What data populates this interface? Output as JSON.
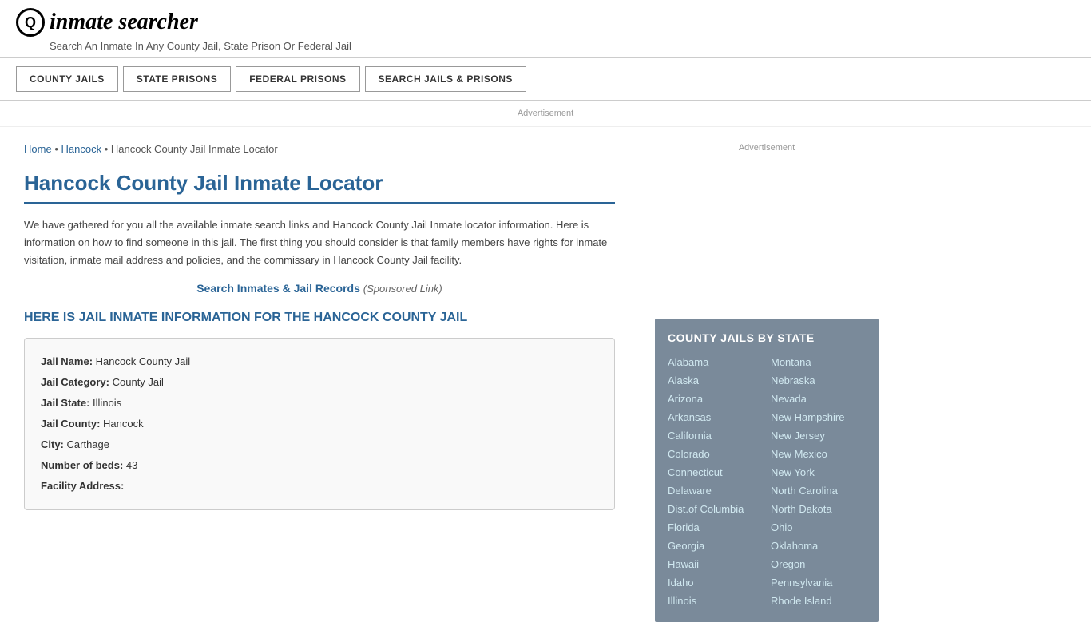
{
  "header": {
    "logo_icon": "🔍",
    "logo_text": "inmate searcher",
    "tagline": "Search An Inmate In Any County Jail, State Prison Or Federal Jail"
  },
  "nav": {
    "items": [
      {
        "label": "COUNTY JAILS",
        "id": "county-jails"
      },
      {
        "label": "STATE PRISONS",
        "id": "state-prisons"
      },
      {
        "label": "FEDERAL PRISONS",
        "id": "federal-prisons"
      },
      {
        "label": "SEARCH JAILS & PRISONS",
        "id": "search-jails-prisons"
      }
    ]
  },
  "ad_banner": "Advertisement",
  "breadcrumb": {
    "home": "Home",
    "county": "Hancock",
    "current": "Hancock County Jail Inmate Locator"
  },
  "page_title": "Hancock County Jail Inmate Locator",
  "description": "We have gathered for you all the available inmate search links and Hancock County Jail Inmate locator information. Here is information on how to find someone in this jail. The first thing you should consider is that family members have rights for inmate visitation, inmate mail address and policies, and the commissary in Hancock County Jail facility.",
  "sponsored_link": {
    "text": "Search Inmates & Jail Records",
    "label": "(Sponsored Link)"
  },
  "section_heading": "HERE IS JAIL INMATE INFORMATION FOR THE HANCOCK COUNTY JAIL",
  "info_card": {
    "fields": [
      {
        "label": "Jail Name:",
        "value": "Hancock County Jail"
      },
      {
        "label": "Jail Category:",
        "value": "County Jail"
      },
      {
        "label": "Jail State:",
        "value": "Illinois"
      },
      {
        "label": "Jail County:",
        "value": "Hancock"
      },
      {
        "label": "City:",
        "value": "Carthage"
      },
      {
        "label": "Number of beds:",
        "value": "43"
      },
      {
        "label": "Facility Address:",
        "value": ""
      }
    ]
  },
  "sidebar": {
    "ad_label": "Advertisement",
    "county_jails_heading": "COUNTY JAILS BY STATE",
    "states_col1": [
      "Alabama",
      "Alaska",
      "Arizona",
      "Arkansas",
      "California",
      "Colorado",
      "Connecticut",
      "Delaware",
      "Dist.of Columbia",
      "Florida",
      "Georgia",
      "Hawaii",
      "Idaho",
      "Illinois"
    ],
    "states_col2": [
      "Montana",
      "Nebraska",
      "Nevada",
      "New Hampshire",
      "New Jersey",
      "New Mexico",
      "New York",
      "North Carolina",
      "North Dakota",
      "Ohio",
      "Oklahoma",
      "Oregon",
      "Pennsylvania",
      "Rhode Island"
    ]
  }
}
